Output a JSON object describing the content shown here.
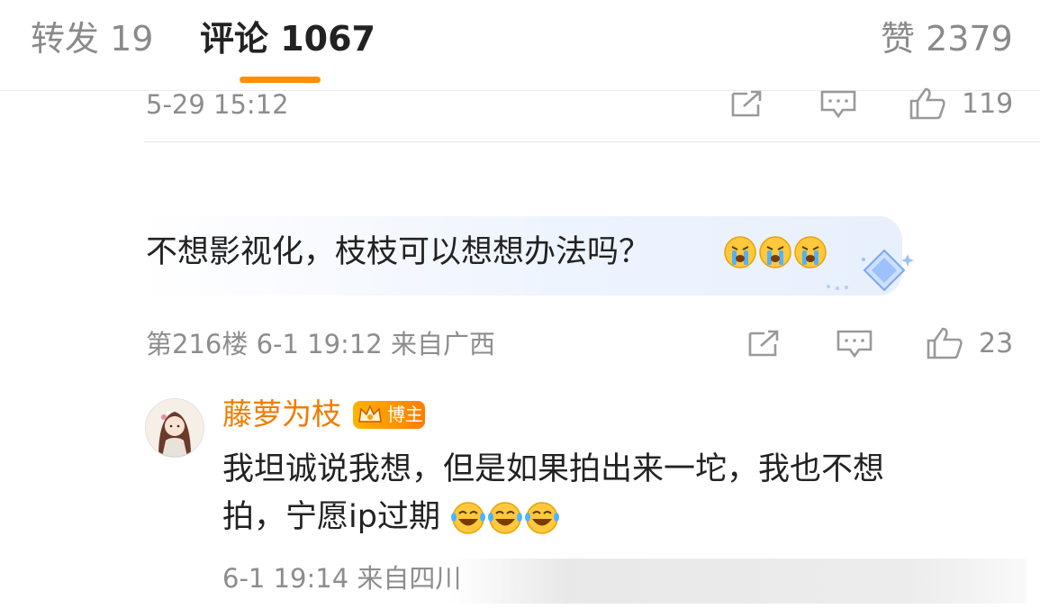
{
  "tabs": {
    "repost": "转发 19",
    "comments": "评论 1067",
    "likes": "赞 2379"
  },
  "prev_comment": {
    "time": "5-29 15:12",
    "like_count": "119"
  },
  "comment": {
    "text": "不想影视化，枝枝可以想想办法吗？",
    "emoji": "crying-face",
    "meta": "第216楼 6-1 19:12 来自广西",
    "like_count": "23"
  },
  "reply": {
    "username": "藤萝为枝",
    "badge": "博主",
    "line1": "我坦诚说我想，但是如果拍出来一坨，我也不想",
    "line2": "拍，宁愿ip过期",
    "emoji": "laughing-tears-face",
    "meta": "6-1 19:14 来自四川"
  },
  "colors": {
    "accent": "#ff8f00",
    "username": "#f07c00",
    "meta": "#8d8d8d"
  }
}
